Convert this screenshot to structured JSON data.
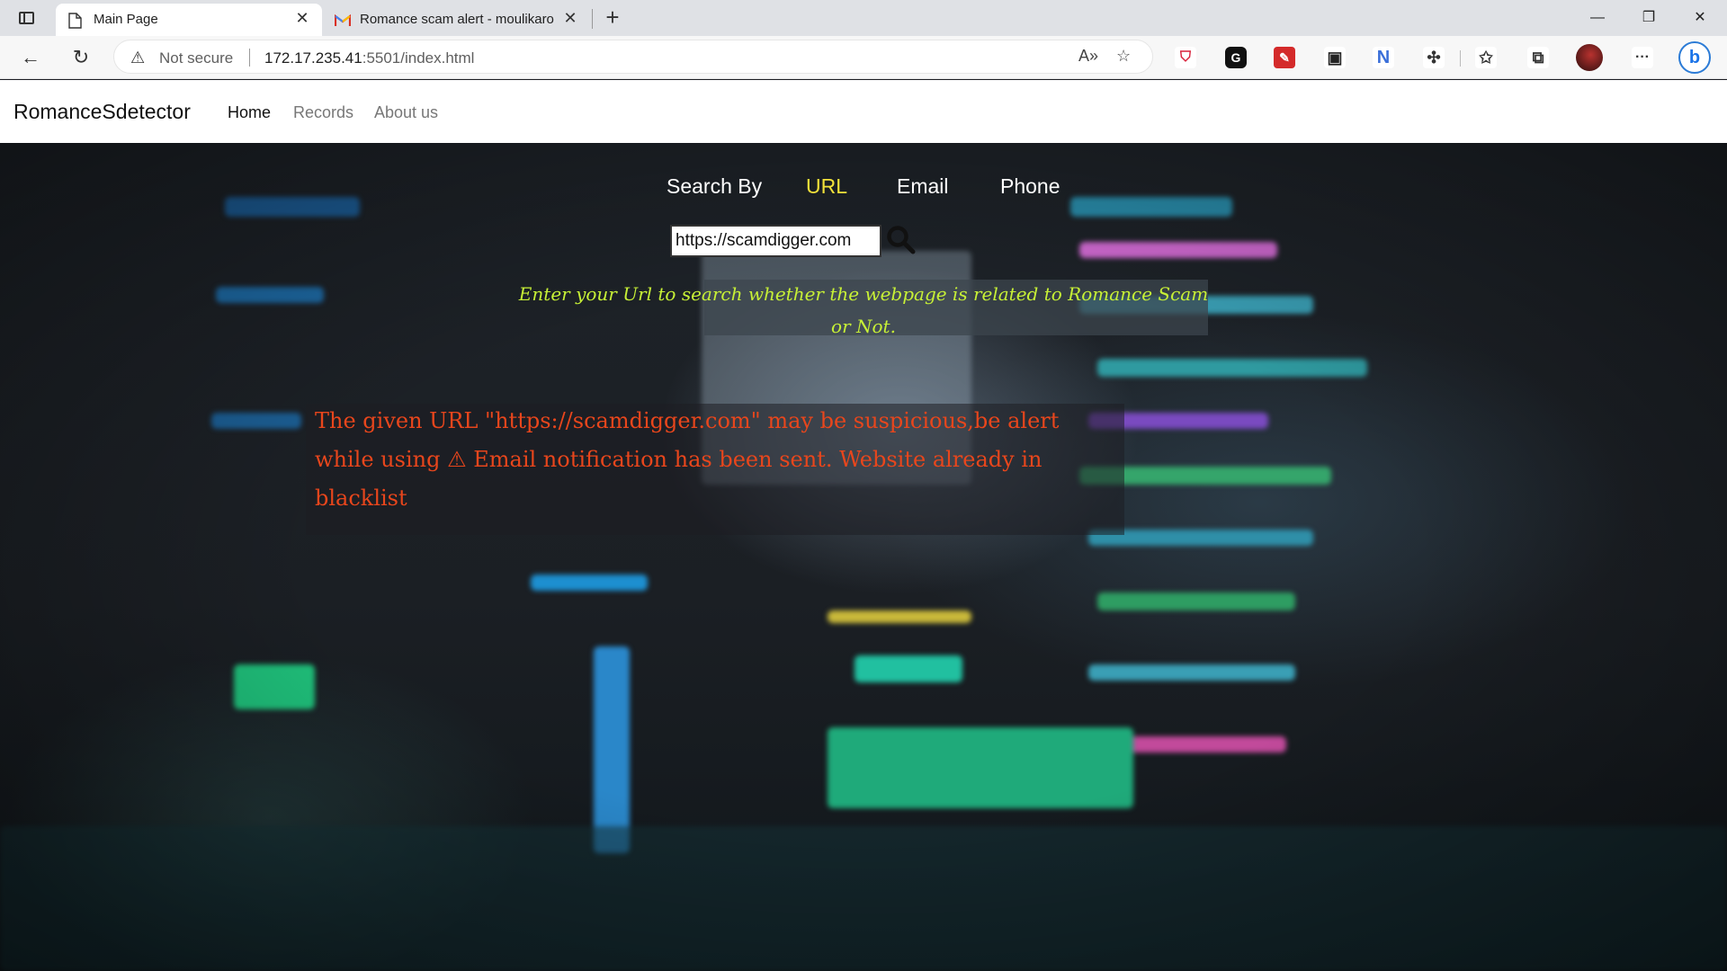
{
  "browser": {
    "tabs": [
      {
        "title": "Main Page",
        "icon": "page-icon",
        "active": true
      },
      {
        "title": "Romance scam alert - moulikaro",
        "icon": "gmail-icon",
        "active": false
      }
    ],
    "address": {
      "security_label": "Not secure",
      "host": "172.17.235.41",
      "path": ":5501/index.html"
    }
  },
  "site": {
    "brand": "RomanceSdetector",
    "nav": [
      {
        "label": "Home",
        "active": true
      },
      {
        "label": "Records",
        "active": false
      },
      {
        "label": "About us",
        "active": false
      }
    ]
  },
  "search": {
    "label": "Search By",
    "options": [
      "URL",
      "Email",
      "Phone"
    ],
    "selected": "URL",
    "input_value": "https://scamdigger.com",
    "help_text": "Enter your Url to search whether the webpage is related to Romance Scam or Not."
  },
  "result": {
    "message": "The given URL \"https://scamdigger.com\" may be suspicious,be alert while using ⚠ Email notification has been sent. Website already in blacklist"
  },
  "colors": {
    "selected_option": "#f2e13a",
    "help_text": "#c7f036",
    "alert_text": "#e8461c"
  }
}
